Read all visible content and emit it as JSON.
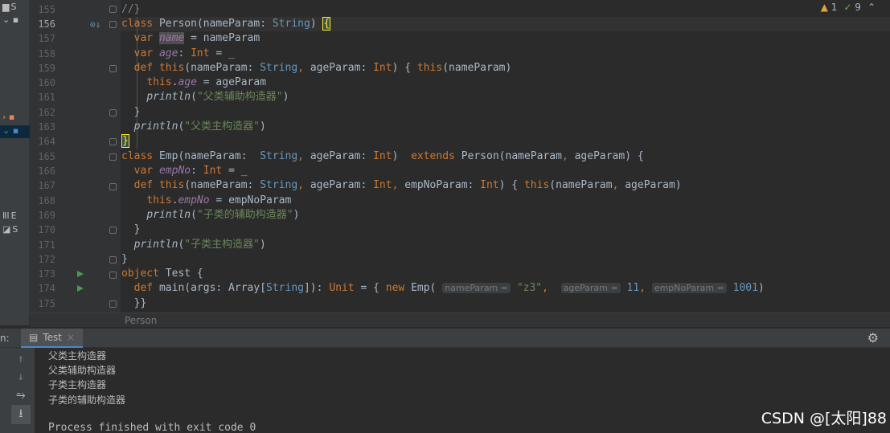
{
  "project": {
    "items": [
      {
        "prefix": "S"
      },
      {
        "prefix": "E"
      },
      {
        "prefix": "S"
      }
    ]
  },
  "inspection": {
    "warnings": "1",
    "ok": "9"
  },
  "lines": [
    {
      "num": "155"
    },
    {
      "num": "156"
    },
    {
      "num": "157"
    },
    {
      "num": "158"
    },
    {
      "num": "159"
    },
    {
      "num": "160"
    },
    {
      "num": "161"
    },
    {
      "num": "162"
    },
    {
      "num": "163"
    },
    {
      "num": "164"
    },
    {
      "num": "165"
    },
    {
      "num": "166"
    },
    {
      "num": "167"
    },
    {
      "num": "168"
    },
    {
      "num": "169"
    },
    {
      "num": "170"
    },
    {
      "num": "171"
    },
    {
      "num": "172"
    },
    {
      "num": "173"
    },
    {
      "num": "174"
    },
    {
      "num": "175"
    }
  ],
  "code": {
    "l155": "//}",
    "l163_text": "父类主构造器",
    "l161_text": "父类辅助构造器",
    "l169_text": "子类的辅助构造器",
    "l171_text": "子类主构造器",
    "hint_nameParam": "nameParam =",
    "hint_ageParam": "ageParam =",
    "hint_empNoParam": "empNoParam =",
    "arg_z3": "\"z3\"",
    "arg_age": "11",
    "arg_empno": "1001"
  },
  "breadcrumb": "Person",
  "run": {
    "label": "n:",
    "tab": "Test",
    "output": [
      "父类主构造器",
      "父类辅助构造器",
      "子类主构造器",
      "子类的辅助构造器"
    ],
    "exit": "Process finished with exit code 0"
  },
  "watermark": "CSDN @[太阳]88"
}
